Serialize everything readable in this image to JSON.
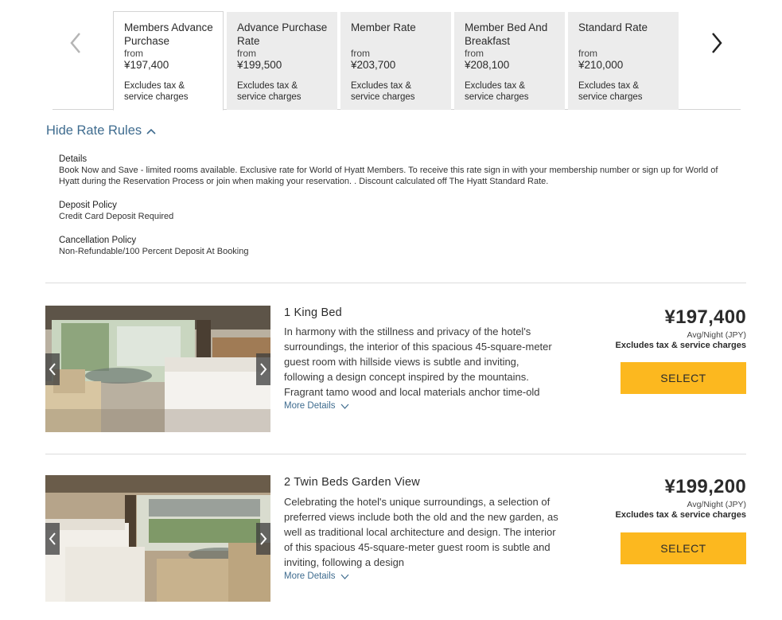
{
  "tabs": [
    {
      "name": "Members Advance Purchase",
      "from": "from",
      "price": "¥197,400",
      "note": "Excludes tax & service charges",
      "active": true
    },
    {
      "name": "Advance Purchase Rate",
      "from": "from",
      "price": "¥199,500",
      "note": "Excludes tax & service charges",
      "active": false
    },
    {
      "name": "Member Rate",
      "from": "from",
      "price": "¥203,700",
      "note": "Excludes tax & service charges",
      "active": false
    },
    {
      "name": "Member Bed And Breakfast",
      "from": "from",
      "price": "¥208,100",
      "note": "Excludes tax & service charges",
      "active": false
    },
    {
      "name": "Standard Rate",
      "from": "from",
      "price": "¥210,000",
      "note": "Excludes tax & service charges",
      "active": false
    }
  ],
  "rate_rules": {
    "toggle_label": "Hide Rate Rules",
    "details_heading": "Details",
    "details_text": "Book Now and Save - limited rooms available. Exclusive rate for World of Hyatt Members. To receive this rate sign in with your membership number or sign up for World of Hyatt during the Reservation Process or join when making your reservation. . Discount calculated off The Hyatt Standard Rate.",
    "deposit_heading": "Deposit Policy",
    "deposit_text": "Credit Card Deposit Required",
    "cancel_heading": "Cancellation Policy",
    "cancel_text": "Non-Refundable/100 Percent Deposit At Booking"
  },
  "rooms": [
    {
      "title": "1 King Bed",
      "description": "In harmony with the stillness and privacy of the hotel's surroundings, the interior of this spacious 45-square-meter guest room with hillside views is subtle and inviting, following a design concept inspired by the mountains. Fragrant tamo wood and local materials anchor time-old",
      "more_label": "More Details",
      "price": "¥197,400",
      "unit": "Avg/Night (JPY)",
      "note": "Excludes tax & service charges",
      "select_label": "SELECT"
    },
    {
      "title": "2 Twin Beds Garden View",
      "description": "Celebrating the hotel's unique surroundings, a selection of preferred views include both the old and the new garden, as well as traditional local architecture and design. The interior of this spacious 45-square-meter guest room is subtle and inviting, following a design",
      "more_label": "More Details",
      "price": "¥199,200",
      "unit": "Avg/Night (JPY)",
      "note": "Excludes tax & service charges",
      "select_label": "SELECT"
    }
  ],
  "colors": {
    "accent_link": "#3f6c8f",
    "select_button": "#fcb81f",
    "tab_inactive": "#ececec"
  }
}
